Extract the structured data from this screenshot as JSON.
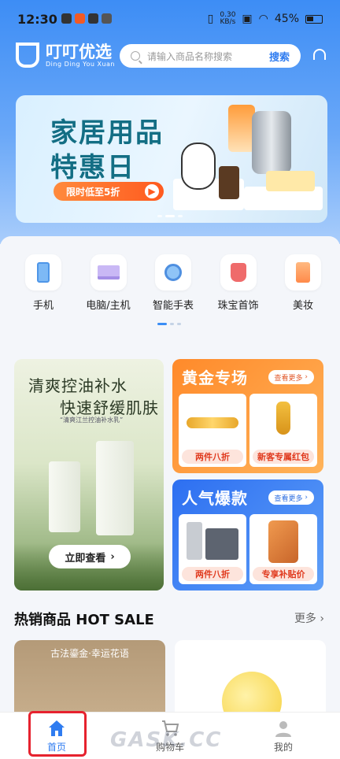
{
  "status_bar": {
    "time": "12:30",
    "net_speed_value": "0.30",
    "net_speed_unit": "KB/s",
    "battery": "45%"
  },
  "header": {
    "logo_title": "叮叮优选",
    "logo_subtitle": "Ding Ding You Xuan",
    "search_placeholder": "请输入商品名称搜索",
    "search_button": "搜索",
    "icons": [
      "headset-icon"
    ]
  },
  "banner": {
    "line1": "家居用品",
    "line2": "特惠日",
    "pill": "限时低至5折"
  },
  "categories": [
    {
      "label": "手机",
      "icon": "phone-icon"
    },
    {
      "label": "电脑/主机",
      "icon": "laptop-icon"
    },
    {
      "label": "智能手表",
      "icon": "watch-icon"
    },
    {
      "label": "珠宝首饰",
      "icon": "jewelry-icon"
    },
    {
      "label": "美妆",
      "icon": "cosmetics-icon"
    }
  ],
  "promo_left": {
    "title1": "清爽控油补水",
    "title2": "快速舒缓肌肤",
    "subtitle": "“清爽江兰控油补水乳”",
    "button": "立即查看"
  },
  "gold": {
    "title": "黄金专场",
    "more": "查看更多",
    "tags": [
      "两件八折",
      "新客专属红包"
    ]
  },
  "hot": {
    "title": "人气爆款",
    "more": "查看更多",
    "tags": [
      "两件八折",
      "专享补贴价"
    ]
  },
  "hot_sale": {
    "title": "热销商品 HOT SALE",
    "more": "更多",
    "product1_text": "古法鎏金·幸运花语"
  },
  "tabbar": [
    {
      "label": "首页",
      "active": true
    },
    {
      "label": "购物车",
      "active": false
    },
    {
      "label": "我的",
      "active": false
    }
  ],
  "colors": {
    "brand": "#2f7cf0",
    "accent": "#ff5a1f",
    "highlight_box": "#e6222e"
  },
  "watermark": "GASK.CC"
}
